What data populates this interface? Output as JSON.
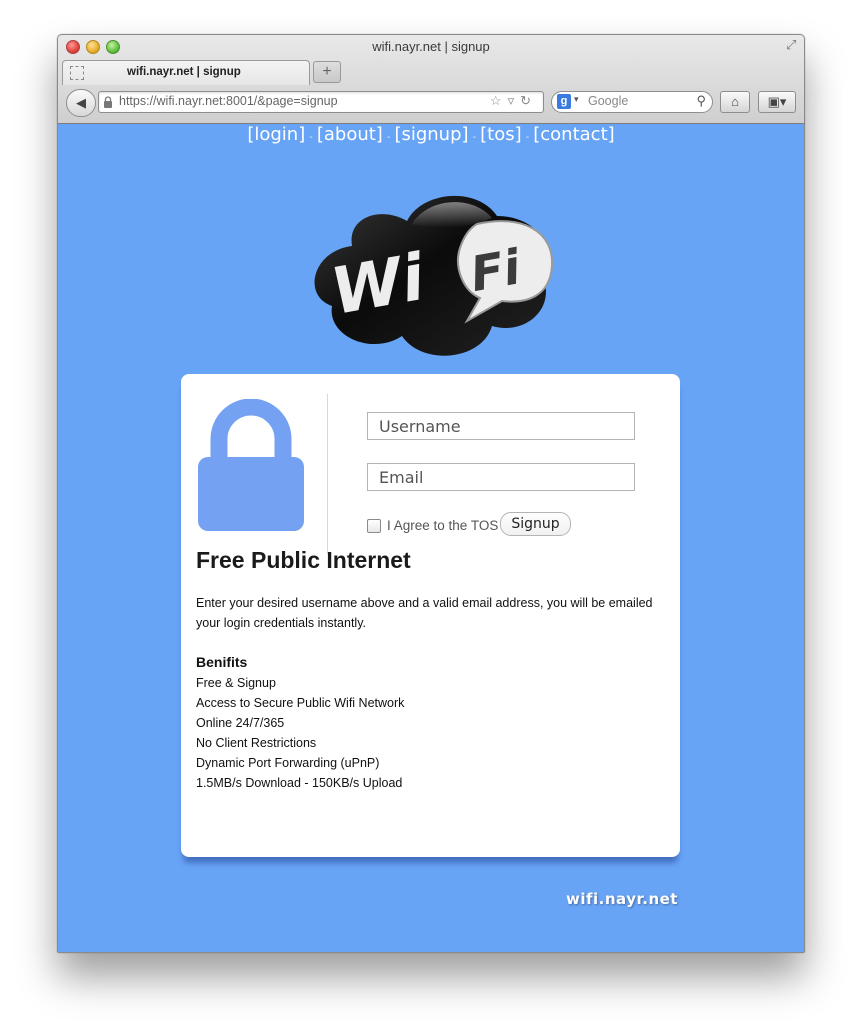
{
  "window": {
    "title": "wifi.nayr.net | signup",
    "tab_label": "wifi.nayr.net | signup",
    "new_tab_symbol": "+",
    "url": "https://wifi.nayr.net:8001/&page=signup",
    "search_placeholder": "Google",
    "search_engine_letter": "g"
  },
  "nav": {
    "items": [
      "[login]",
      "[about]",
      "[signup]",
      "[tos]",
      "[contact]"
    ],
    "separator": "-"
  },
  "logo": {
    "left_text": "Wi",
    "right_text": "Fi"
  },
  "form": {
    "username_placeholder": "Username",
    "email_placeholder": "Email",
    "agree_label": "I Agree to the TOS",
    "agree_checked": false,
    "submit_label": "Signup"
  },
  "content": {
    "title": "Free Public Internet",
    "description": "Enter your desired username above and a valid email address, you will be emailed your login credentials instantly.",
    "benefits_heading": "Benifits",
    "benefits": [
      "Free & Signup",
      "Access to Secure Public Wifi Network",
      "Online 24/7/365",
      "No Client Restrictions",
      "Dynamic Port Forwarding (uPnP)",
      "1.5MB/s Download - 150KB/s Upload"
    ]
  },
  "footer": {
    "brand": "wifi.nayr.net"
  },
  "colors": {
    "page_background": "#68a4f6",
    "lock_icon": "#75a1f2",
    "card_background": "#ffffff"
  }
}
